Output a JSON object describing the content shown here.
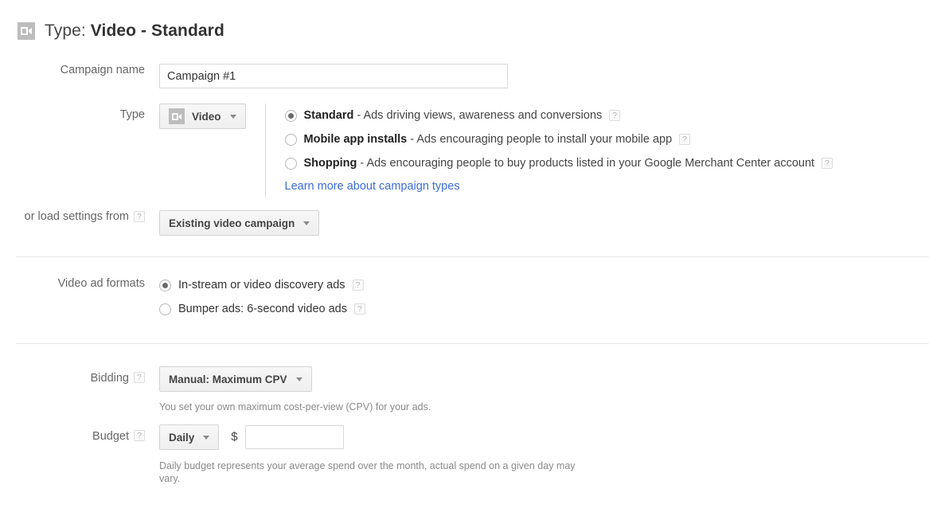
{
  "header": {
    "icon": "video-camera-icon",
    "prefix": "Type: ",
    "value": "Video - Standard"
  },
  "campaign_name": {
    "label": "Campaign name",
    "value": "Campaign #1",
    "placeholder": ""
  },
  "type": {
    "label": "Type",
    "dropdown_label": "Video",
    "dropdown_icon": "video-camera-icon",
    "help_glyph": "?",
    "options": [
      {
        "id": "standard",
        "title": "Standard",
        "description": " - Ads driving views, awareness and conversions",
        "selected": true,
        "help": "?"
      },
      {
        "id": "mobile-app-installs",
        "title": "Mobile app installs",
        "description": " - Ads encouraging people to install your mobile app",
        "selected": false,
        "help": "?"
      },
      {
        "id": "shopping",
        "title": "Shopping",
        "description": " - Ads encouraging people to buy products listed in your Google Merchant Center account",
        "selected": false,
        "help": "?"
      }
    ],
    "learn_more": "Learn more about campaign types"
  },
  "load_settings": {
    "label": "or load settings from",
    "help": "?",
    "dropdown_label": "Existing video campaign"
  },
  "video_ad_formats": {
    "label": "Video ad formats",
    "options": [
      {
        "id": "in-stream",
        "title": "In-stream or video discovery ads",
        "selected": true,
        "help": "?"
      },
      {
        "id": "bumper",
        "title": "Bumper ads: 6-second video ads",
        "selected": false,
        "help": "?"
      }
    ]
  },
  "bidding": {
    "label": "Bidding",
    "help": "?",
    "dropdown_label": "Manual: Maximum CPV",
    "helper_text": "You set your own maximum cost-per-view (CPV) for your ads."
  },
  "budget": {
    "label": "Budget",
    "help": "?",
    "dropdown_label": "Daily",
    "currency_symbol": "$",
    "amount_value": "",
    "amount_placeholder": "",
    "helper_text": "Daily budget represents your average spend over the month, actual spend on a given day may vary."
  },
  "colors": {
    "link": "#3d6dd6",
    "label_text": "#666666",
    "body_text": "#333333",
    "chip_gray": "#bdbdbd",
    "divider": "#e8e8e8"
  }
}
